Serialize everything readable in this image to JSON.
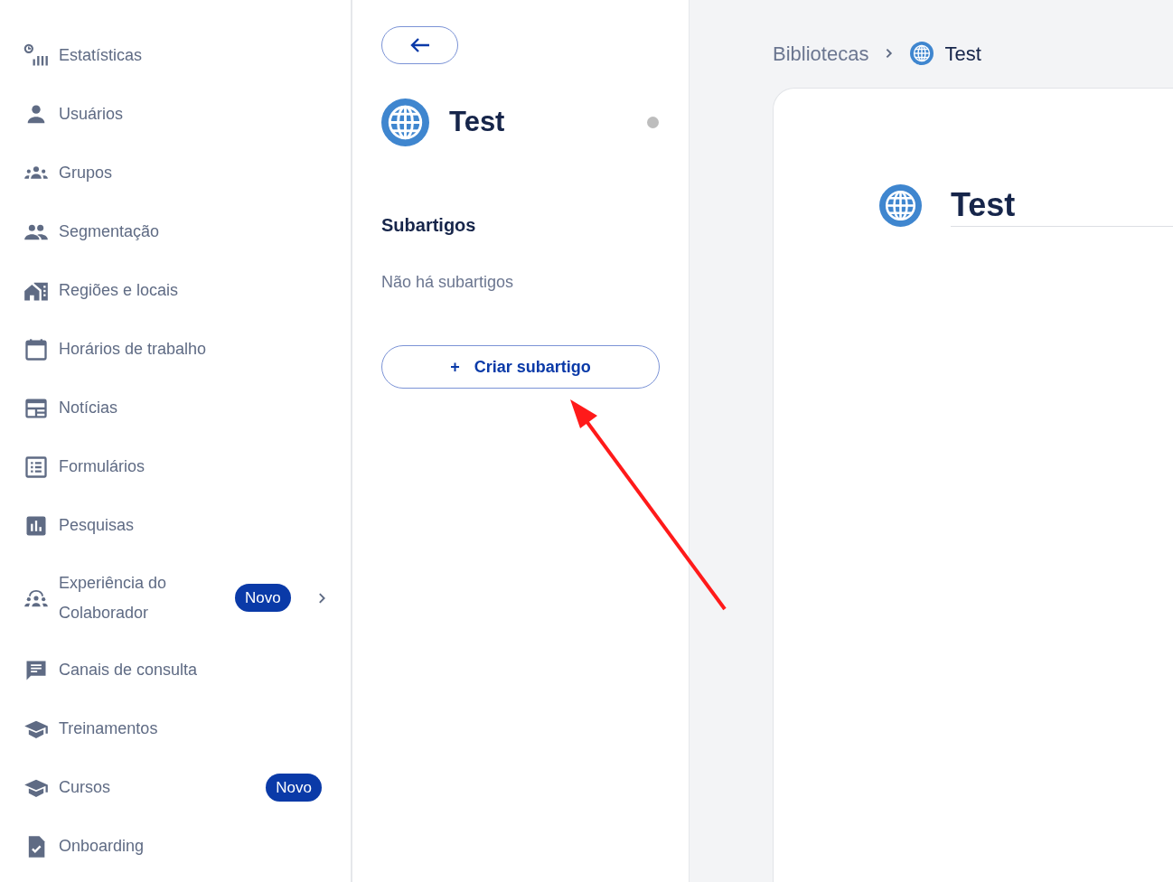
{
  "sidebar": {
    "items": [
      {
        "label": "Estatísticas"
      },
      {
        "label": "Usuários"
      },
      {
        "label": "Grupos"
      },
      {
        "label": "Segmentação"
      },
      {
        "label": "Regiões e locais"
      },
      {
        "label": "Horários de trabalho"
      },
      {
        "label": "Notícias"
      },
      {
        "label": "Formulários"
      },
      {
        "label": "Pesquisas"
      },
      {
        "label": "Experiência do Colaborador",
        "badge": "Novo",
        "expandable": true
      },
      {
        "label": "Canais de consulta"
      },
      {
        "label": "Treinamentos"
      },
      {
        "label": "Cursos",
        "badge": "Novo"
      },
      {
        "label": "Onboarding"
      }
    ]
  },
  "article_panel": {
    "title": "Test",
    "section_title": "Subartigos",
    "empty_text": "Não há subartigos",
    "create_button": "Criar subartigo",
    "create_icon": "+"
  },
  "breadcrumb": [
    {
      "label": "Bibliotecas"
    },
    {
      "label": "Test",
      "globe": true
    }
  ],
  "editor": {
    "title": "Test"
  }
}
